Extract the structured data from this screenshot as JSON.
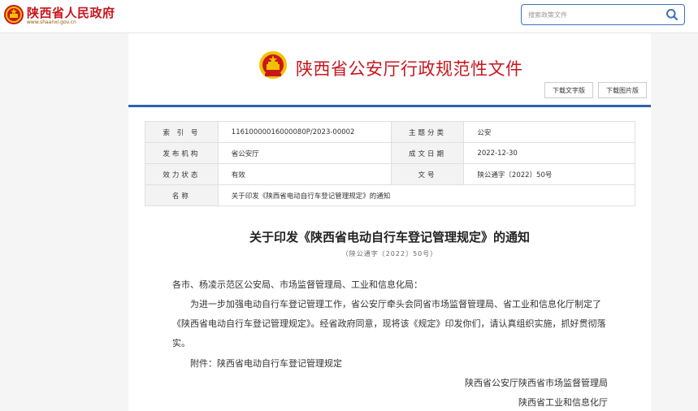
{
  "site": {
    "name": "陕西省人民政府",
    "url": "www.shaanxi.gov.cn",
    "search_placeholder": "搜索政策文件"
  },
  "header": {
    "title": "陕西省公安厅行政规范性文件",
    "download_word": "下载文字版",
    "download_image": "下载图片版"
  },
  "info": {
    "index_label": "索 引 号",
    "index_value": "11610000016000080P/2023-00002",
    "category_label": "主题分类",
    "category_value": "公安",
    "issuer_label": "发布机构",
    "issuer_value": "省公安厅",
    "date_label": "成文日期",
    "date_value": "2022-12-30",
    "status_label": "效力状态",
    "status_value": "有效",
    "docno_label": "文号",
    "docno_value": "陕公通字〔2022〕50号",
    "name_label": "名称",
    "name_value": "关于印发《陕西省电动自行车登记管理规定》的通知"
  },
  "notice": {
    "title": "关于印发《陕西省电动自行车登记管理规定》的通知",
    "doc_no": "（陕公通字〔2022〕50号）",
    "addressee": "各市、杨凌示范区公安局、市场监督管理局、工业和信息化局：",
    "body": "为进一步加强电动自行车登记管理工作，省公安厅牵头会同省市场监督管理局、省工业和信息化厅制定了《陕西省电动自行车登记管理规定》。经省政府同意，现将该《规定》印发你们，请认真组织实施，抓好贯彻落实。",
    "attachment": "附件：陕西省电动自行车登记管理规定",
    "signer_1": "陕西省公安厅陕西省市场监督管理局",
    "signer_2": "陕西省工业和信息化厅"
  },
  "colors": {
    "brand_red": "#c8161d",
    "accent_blue": "#3061ae",
    "emblem_gold": "#f2c200"
  },
  "icons": [
    "national-emblem-icon",
    "search-icon"
  ]
}
